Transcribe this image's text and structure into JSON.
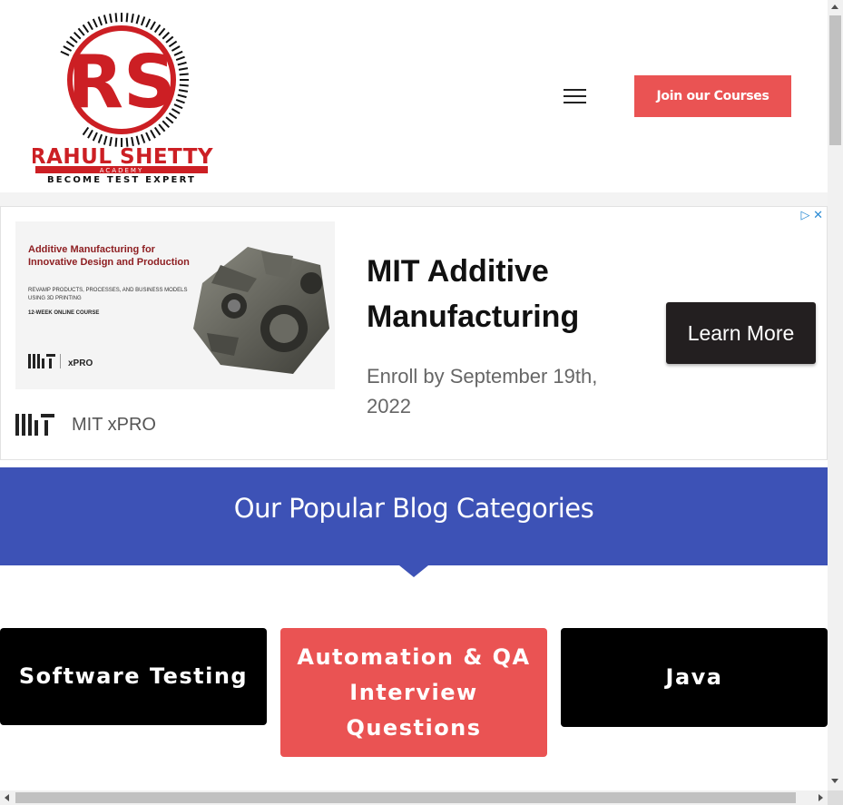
{
  "header": {
    "logo": {
      "name": "RAHUL SHETTY",
      "sub": "ACADEMY",
      "tagline": "BECOME TEST EXPERT",
      "monogram": "RS"
    },
    "menu_icon": "hamburger-icon",
    "join_button": "Join our Courses"
  },
  "ad": {
    "image": {
      "title": "Additive Manufacturing for Innovative Design and Production",
      "subtitle": "REVAMP PRODUCTS, PROCESSES, AND BUSINESS MODELS USING 3D PRINTING",
      "course": "12-WEEK ONLINE COURSE",
      "brand": "xPRO"
    },
    "brand_name": "MIT xPRO",
    "headline": "MIT Additive Manufacturing",
    "subtext": "Enroll by September 19th, 2022",
    "cta": "Learn More",
    "adchoices_icon": "adchoices-icon",
    "close_icon": "close-icon"
  },
  "categories": {
    "title": "Our Popular Blog Categories",
    "items": [
      {
        "label": "Software Testing"
      },
      {
        "label": "Automation & QA Interview Questions"
      },
      {
        "label": "Java"
      }
    ]
  },
  "colors": {
    "accent_red": "#ea5353",
    "band_blue": "#3d52b6",
    "logo_red": "#cc1f24"
  }
}
